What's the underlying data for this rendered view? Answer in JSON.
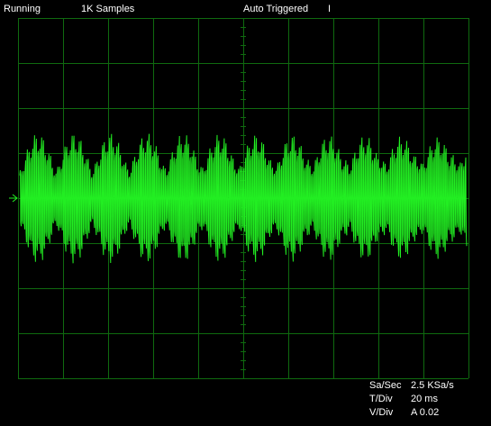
{
  "status_bar": {
    "run_state": "Running",
    "samples": "1K Samples",
    "trigger_mode": "Auto Triggered",
    "trigger_position_marker": "I"
  },
  "readouts": {
    "sample_rate": {
      "label": "Sa/Sec",
      "value": "2.5 KSa/s"
    },
    "time_per_div": {
      "label": "T/Div",
      "value": "20 ms"
    },
    "volts_per_div": {
      "label": "V/Div",
      "value": "A 0.02"
    }
  },
  "screen": {
    "grid_divisions": {
      "horizontal": 10,
      "vertical": 8
    },
    "grid_color": "#0f6a0f",
    "trace_color": "#22ee22",
    "background_color": "#000000",
    "channel_marker_icon": "right-arrow-icon"
  }
}
